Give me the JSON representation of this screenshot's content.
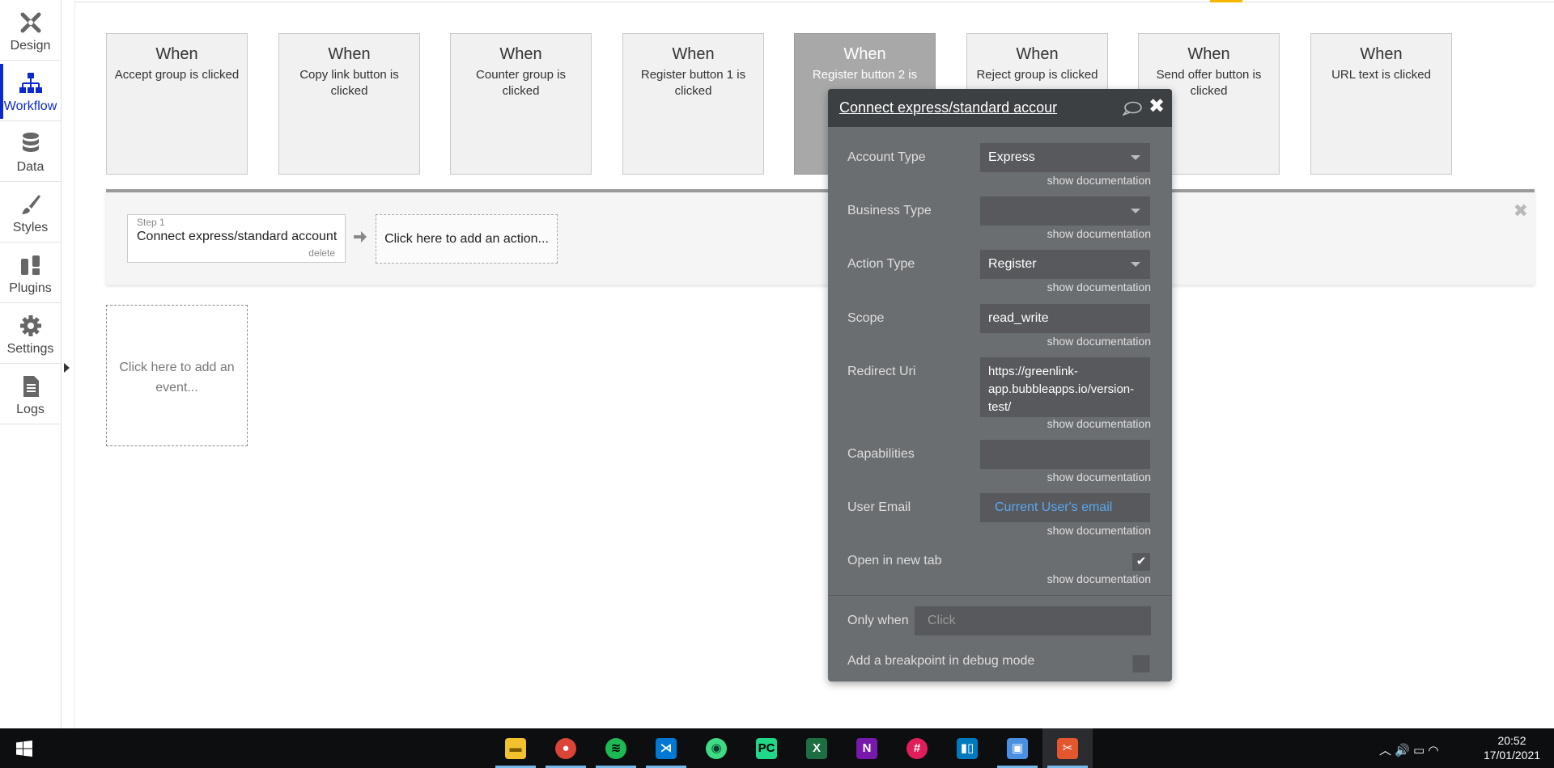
{
  "sidebar": {
    "items": [
      {
        "label": "Design",
        "icon": "design-icon"
      },
      {
        "label": "Workflow",
        "icon": "workflow-icon"
      },
      {
        "label": "Data",
        "icon": "database-icon"
      },
      {
        "label": "Styles",
        "icon": "brush-icon"
      },
      {
        "label": "Plugins",
        "icon": "plug-icon"
      },
      {
        "label": "Settings",
        "icon": "gear-icon"
      },
      {
        "label": "Logs",
        "icon": "document-icon"
      }
    ],
    "active": "Workflow",
    "active_color": "#0c29d0"
  },
  "events": [
    {
      "when": "When",
      "desc": "Accept group is clicked"
    },
    {
      "when": "When",
      "desc": "Copy link button is clicked"
    },
    {
      "when": "When",
      "desc": "Counter group is clicked"
    },
    {
      "when": "When",
      "desc": "Register button 1 is clicked"
    },
    {
      "when": "When",
      "desc": "Register button 2 is"
    },
    {
      "when": "When",
      "desc": "Reject group is clicked"
    },
    {
      "when": "When",
      "desc": "Send offer button is clicked"
    },
    {
      "when": "When",
      "desc": "URL text is clicked"
    }
  ],
  "steps": {
    "step1_label": "Step 1",
    "step1_name": "Connect express/standard account",
    "step1_delete": "delete",
    "add_action": "Click here to add an action..."
  },
  "add_event": "Click here to add an event...",
  "panel": {
    "title": "Connect express/standard accour",
    "doc_label": "show documentation",
    "fields": {
      "account_type": {
        "label": "Account Type",
        "value": "Express"
      },
      "business_type": {
        "label": "Business Type",
        "value": ""
      },
      "action_type": {
        "label": "Action Type",
        "value": "Register"
      },
      "scope": {
        "label": "Scope",
        "value": "read_write"
      },
      "redirect_uri": {
        "label": "Redirect Uri",
        "value": "https://greenlink-app.bubbleapps.io/version-test/"
      },
      "capabilities": {
        "label": "Capabilities",
        "value": ""
      },
      "user_email": {
        "label": "User Email",
        "value": "Current User's email"
      },
      "open_new_tab": {
        "label": "Open in new tab",
        "checked": true
      }
    },
    "only_when_label": "Only when",
    "only_when_placeholder": "Click",
    "breakpoint_label": "Add a breakpoint in debug mode",
    "bg_color": "#6b6e71",
    "link_color": "#5aa9f2"
  },
  "taskbar": {
    "apps": [
      "file-explorer-icon",
      "chrome-icon",
      "spotify-icon",
      "vscode-icon",
      "maps-icon",
      "pycharm-icon",
      "excel-icon",
      "onenote-icon",
      "slack-icon",
      "trello-icon",
      "remote-desktop-icon",
      "bubble-icon"
    ],
    "time": "20:52",
    "date": "17/01/2021"
  }
}
